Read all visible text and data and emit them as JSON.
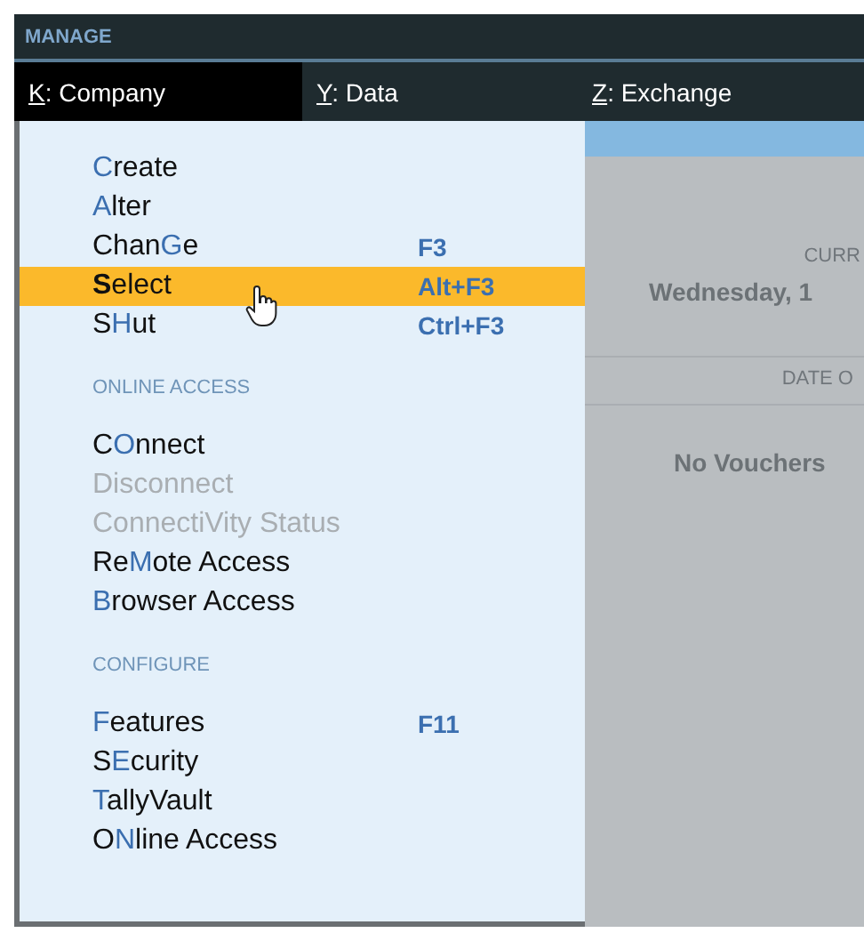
{
  "section_title": "MANAGE",
  "menu_bar": [
    {
      "key": "K",
      "rest": ": Company",
      "selected": true
    },
    {
      "key": "Y",
      "rest": ": Data",
      "selected": false
    },
    {
      "key": "Z",
      "rest": ": Exchange",
      "selected": false
    }
  ],
  "dropdown": {
    "groups": [
      {
        "items": [
          {
            "key": "C",
            "post": "reate",
            "disabled": false,
            "selected": false
          },
          {
            "key": "A",
            "post": "lter",
            "disabled": false,
            "selected": false
          },
          {
            "pre": "Chan",
            "key": "G",
            "post": "e",
            "shortcut": "F3",
            "disabled": false,
            "selected": false
          },
          {
            "key": "S",
            "post": "elect",
            "shortcut": "Alt+F3",
            "disabled": false,
            "selected": true
          },
          {
            "pre": "S",
            "key": "H",
            "post": "ut",
            "shortcut": "Ctrl+F3",
            "disabled": false,
            "selected": false
          }
        ]
      },
      {
        "heading": "ONLINE ACCESS",
        "items": [
          {
            "pre": "C",
            "key": "O",
            "post": "nnect",
            "disabled": false,
            "selected": false
          },
          {
            "pre": "Disconnect",
            "disabled": true,
            "selected": false
          },
          {
            "pre": "Connecti",
            "key": "V",
            "post": "ity Status",
            "disabled": true,
            "selected": false
          },
          {
            "pre": "Re",
            "key": "M",
            "post": "ote Access",
            "disabled": false,
            "selected": false
          },
          {
            "key": "B",
            "post": "rowser Access",
            "disabled": false,
            "selected": false
          }
        ]
      },
      {
        "heading": "CONFIGURE",
        "items": [
          {
            "key": "F",
            "post": "eatures",
            "shortcut": "F11",
            "disabled": false,
            "selected": false
          },
          {
            "pre": "S",
            "key": "E",
            "post": "curity",
            "disabled": false,
            "selected": false
          },
          {
            "key": "T",
            "post": "allyVault",
            "disabled": false,
            "selected": false
          },
          {
            "pre": "O",
            "key": "N",
            "post": "line Access",
            "disabled": false,
            "selected": false
          }
        ]
      }
    ]
  },
  "background": {
    "caption_1": "CURR",
    "date": "Wednesday, 1",
    "caption_2": "DATE O",
    "status": "No Vouchers"
  }
}
